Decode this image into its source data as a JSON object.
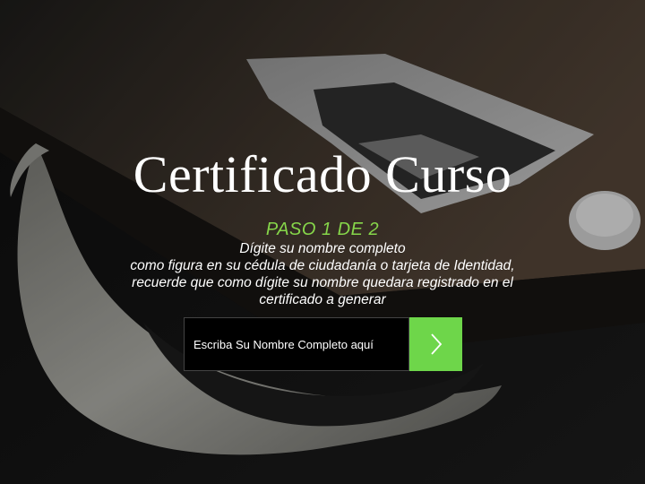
{
  "page": {
    "title": "Certificado Curso",
    "step_label": "PASO 1 DE 2",
    "instructions": [
      "Dígite su nombre completo",
      "como figura en su cédula de ciudadanía o tarjeta de Identidad,",
      "recuerde que como dígite su nombre quedara registrado en el",
      "certificado a generar"
    ]
  },
  "form": {
    "name_placeholder": "Escriba Su Nombre Completo aquí",
    "name_value": "",
    "submit_icon": "chevron-right-icon"
  },
  "colors": {
    "accent_green": "#6ed64a",
    "step_text": "#86d64a",
    "input_bg": "#000000",
    "text": "#ffffff"
  }
}
